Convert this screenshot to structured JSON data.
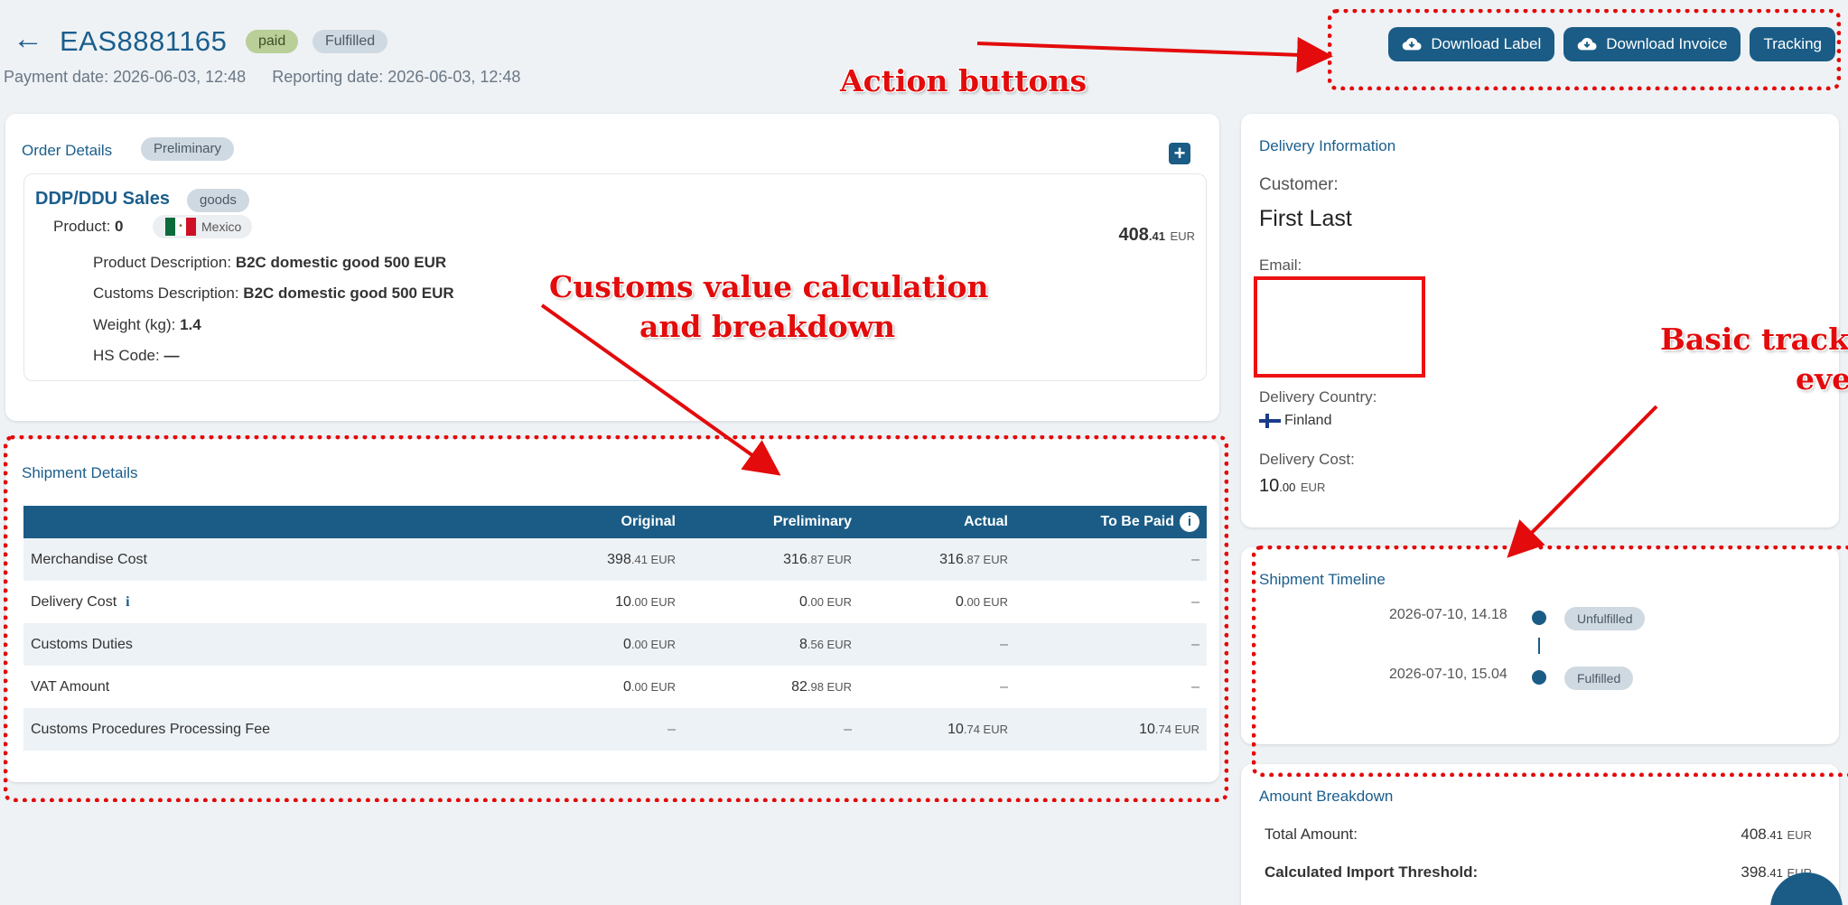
{
  "header": {
    "order_id": "EAS8881165",
    "status_paid": "paid",
    "status_fulfilled": "Fulfilled",
    "payment_date": "Payment date: 2026-06-03, 12:48",
    "reporting_date": "Reporting date: 2026-06-03, 12:48"
  },
  "actions": {
    "download_label": "Download Label",
    "download_invoice": "Download Invoice",
    "tracking": "Tracking"
  },
  "order_details": {
    "title": "Order Details",
    "badge": "Preliminary",
    "sale_title": "DDP/DDU Sales",
    "sale_badge": "goods",
    "product_label": "Product:",
    "product_index": "0",
    "country": "Mexico",
    "price_int": "408",
    "price_dec": ".41",
    "currency": "EUR",
    "product_description_label": "Product Description:",
    "product_description": "B2C domestic good 500 EUR",
    "customs_description_label": "Customs Description:",
    "customs_description": "B2C domestic good 500 EUR",
    "weight_label": "Weight (kg):",
    "weight": "1.4",
    "hs_code_label": "HS Code:",
    "hs_code": "—"
  },
  "shipment_details": {
    "title": "Shipment Details",
    "columns": [
      "",
      "Original",
      "Preliminary",
      "Actual",
      "To Be Paid"
    ],
    "rows": [
      {
        "label": "Merchandise Cost",
        "cells": [
          [
            "398",
            ".41 EUR"
          ],
          [
            "316",
            ".87 EUR"
          ],
          [
            "316",
            ".87 EUR"
          ],
          [
            "–",
            ""
          ]
        ]
      },
      {
        "label": "Delivery Cost",
        "cells": [
          [
            "10",
            ".00 EUR"
          ],
          [
            "0",
            ".00 EUR"
          ],
          [
            "0",
            ".00 EUR"
          ],
          [
            "–",
            ""
          ]
        ]
      },
      {
        "label": "Customs Duties",
        "cells": [
          [
            "0",
            ".00 EUR"
          ],
          [
            "8",
            ".56 EUR"
          ],
          [
            "–",
            ""
          ],
          [
            "–",
            ""
          ]
        ]
      },
      {
        "label": "VAT Amount",
        "cells": [
          [
            "0",
            ".00 EUR"
          ],
          [
            "82",
            ".98 EUR"
          ],
          [
            "–",
            ""
          ],
          [
            "–",
            ""
          ]
        ]
      },
      {
        "label": "Customs Procedures Processing Fee",
        "cells": [
          [
            "–",
            ""
          ],
          [
            "–",
            ""
          ],
          [
            "10",
            ".74 EUR"
          ],
          [
            "10",
            ".74 EUR"
          ]
        ]
      }
    ]
  },
  "delivery": {
    "title": "Delivery Information",
    "customer_label": "Customer:",
    "customer": "First Last",
    "email_label": "Email:",
    "country_label": "Delivery Country:",
    "country": "Finland",
    "cost_label": "Delivery Cost:",
    "cost_int": "10",
    "cost_dec": ".00",
    "cost_currency": "EUR"
  },
  "timeline": {
    "title": "Shipment Timeline",
    "events": [
      {
        "time": "2026-07-10, 14.18",
        "status": "Unfulfilled"
      },
      {
        "time": "2026-07-10, 15.04",
        "status": "Fulfilled"
      }
    ]
  },
  "amount": {
    "title": "Amount Breakdown",
    "total_label": "Total Amount:",
    "total_int": "408",
    "total_dec": ".41",
    "total_currency": "EUR",
    "threshold_label": "Calculated Import Threshold:",
    "threshold_int": "398",
    "threshold_dec": ".41",
    "threshold_currency": "EUR"
  },
  "annotations": {
    "action_buttons": "Action buttons",
    "customs_line1": "Customs value calculation",
    "customs_line2": "and breakdown",
    "tracking_line1": "Basic tracking",
    "tracking_line2": "events"
  },
  "colors": {
    "primary": "#1a5c86",
    "annotation": "#e30b0b"
  }
}
